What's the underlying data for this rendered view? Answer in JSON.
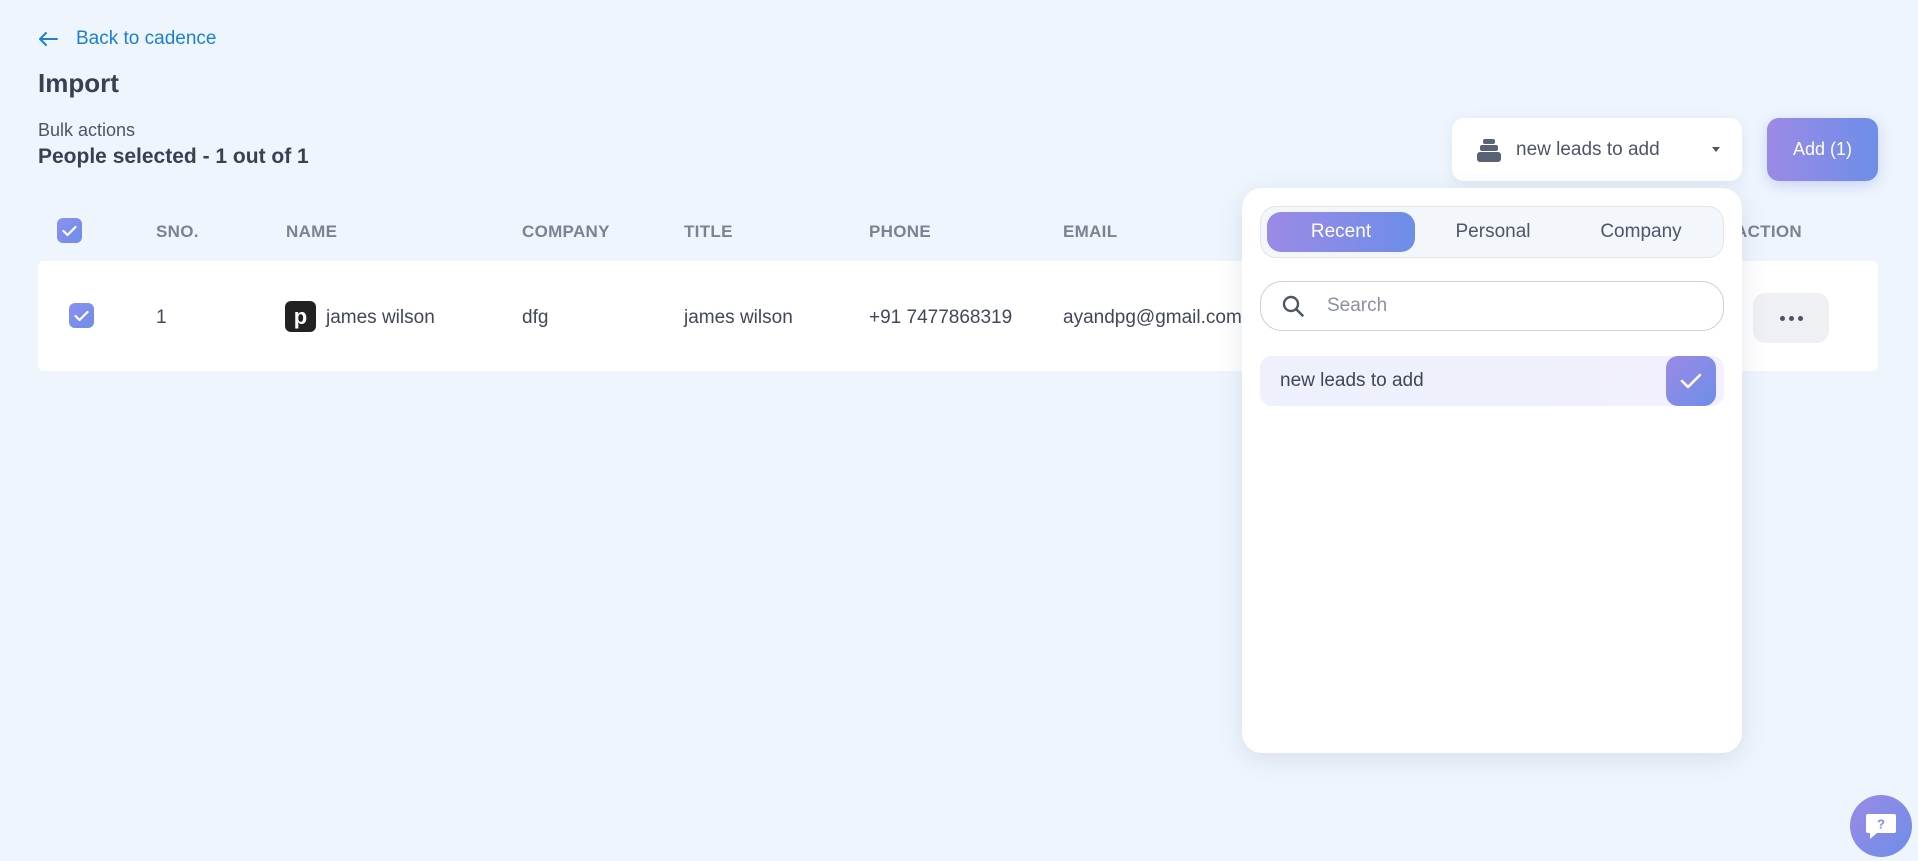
{
  "header": {
    "back_label": "Back to cadence",
    "title": "Import",
    "bulk_label": "Bulk actions",
    "people_selected": "People selected - 1 out of 1"
  },
  "table": {
    "columns": [
      "SNO.",
      "NAME",
      "COMPANY",
      "TITLE",
      "PHONE",
      "EMAIL",
      "ACTION"
    ],
    "rows": [
      {
        "sno": "1",
        "avatar_letter": "p",
        "name": "james wilson",
        "company": "dfg",
        "title": "james wilson",
        "phone": "+91 7477868319",
        "email": "ayandpg@gmail.com"
      }
    ]
  },
  "list_select": {
    "selected": "new leads to add"
  },
  "add_button": "Add (1)",
  "popover": {
    "tabs": [
      "Recent",
      "Personal",
      "Company"
    ],
    "active_tab": "Recent",
    "search_placeholder": "Search",
    "options": [
      "new leads to add"
    ]
  },
  "colors": {
    "accent_start": "#9b8ae6",
    "accent_end": "#6d8ee8",
    "link": "#1c7fd4",
    "background": "#eef5fd"
  }
}
